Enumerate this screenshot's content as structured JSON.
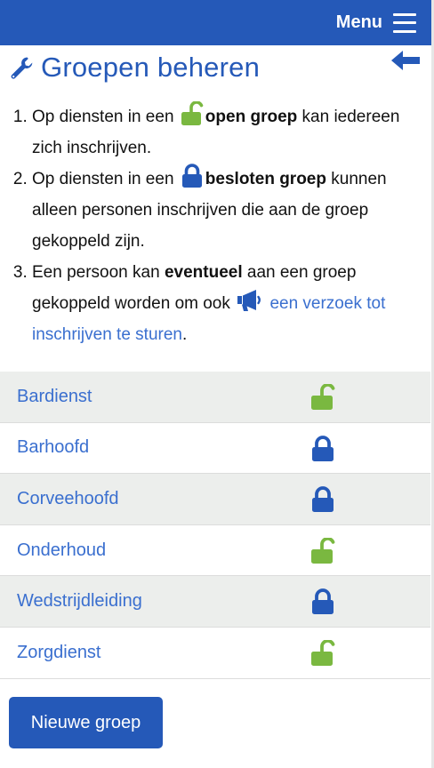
{
  "header": {
    "menu_label": "Menu"
  },
  "page": {
    "title": "Groepen beheren"
  },
  "info": {
    "item1": {
      "pre": "Op diensten in een ",
      "bold": "open groep",
      "post": " kan iedereen zich inschrijven."
    },
    "item2": {
      "pre": "Op diensten in een ",
      "bold": "besloten groep",
      "post": " kunnen alleen personen inschrijven die aan de groep gekoppeld zijn."
    },
    "item3": {
      "pre": "Een persoon kan ",
      "bold": "eventueel",
      "mid": " aan een groep gekoppeld worden om ook ",
      "link": "een verzoek tot inschrijven te sturen",
      "post": "."
    }
  },
  "groups": [
    {
      "name": "Bardienst",
      "status": "open"
    },
    {
      "name": "Barhoofd",
      "status": "closed"
    },
    {
      "name": "Corveehoofd",
      "status": "closed"
    },
    {
      "name": "Onderhoud",
      "status": "open"
    },
    {
      "name": "Wedstrijdleiding",
      "status": "closed"
    },
    {
      "name": "Zorgdienst",
      "status": "open"
    }
  ],
  "actions": {
    "new_group_label": "Nieuwe groep"
  },
  "colors": {
    "brand": "#2559b8",
    "link": "#3a6fcf",
    "open_lock": "#7ab840",
    "closed_lock": "#2559b8",
    "row_alt": "#eceeec"
  },
  "icons": {
    "title": "wrench-icon",
    "back": "back-arrow-icon",
    "menu": "hamburger-menu-icon",
    "open": "open-lock-icon",
    "closed": "closed-lock-icon",
    "request": "megaphone-icon"
  }
}
